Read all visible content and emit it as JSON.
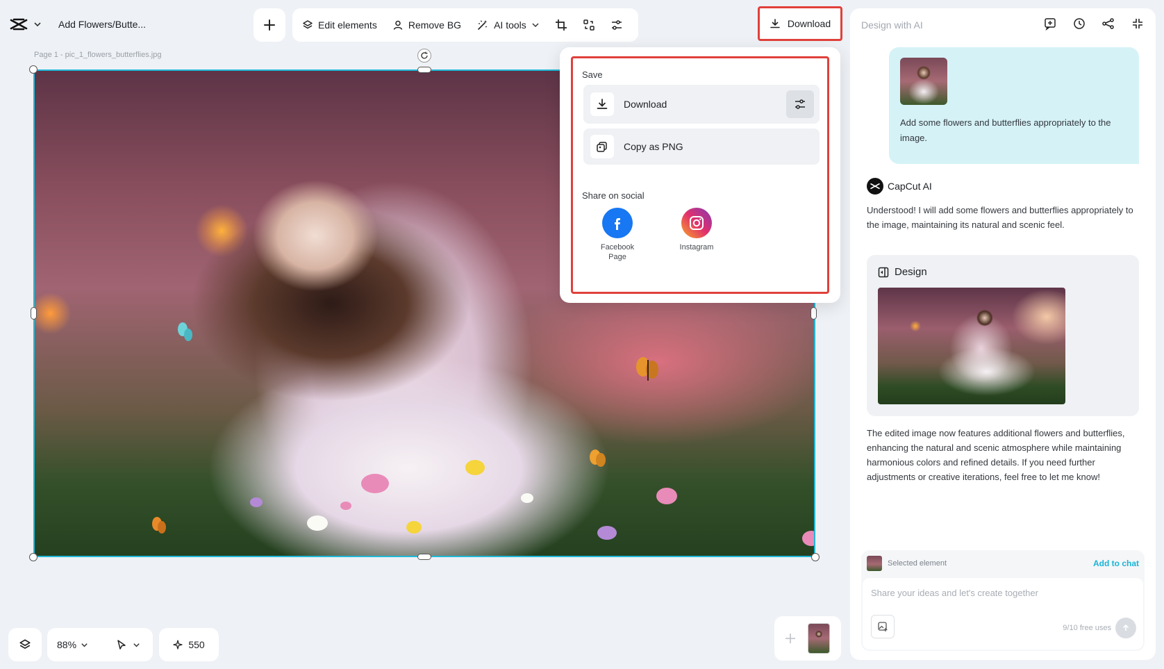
{
  "header": {
    "doc_title": "Add Flowers/Butte...",
    "download_label": "Download"
  },
  "toolbar": {
    "items": [
      {
        "label": "Edit elements",
        "icon": "layers-icon"
      },
      {
        "label": "Remove BG",
        "icon": "person-icon"
      },
      {
        "label": "AI tools",
        "icon": "magic-wand-icon"
      }
    ]
  },
  "canvas": {
    "page_label": "Page 1 -   pic_1_flowers_butterflies.jpg"
  },
  "popup": {
    "save_label": "Save",
    "download_label": "Download",
    "copy_label": "Copy as PNG",
    "share_label": "Share on social",
    "socials": [
      {
        "name": "Facebook\nPage",
        "color": "#1877f2"
      },
      {
        "name": "Instagram",
        "color": "#e1306c"
      }
    ]
  },
  "panel": {
    "title": "Design with AI",
    "user_message": "Add some flowers and butterflies appropriately to the image.",
    "ai_name": "CapCut AI",
    "ai_message": "Understood! I will add some flowers and butterflies appropriately to the image, maintaining its natural and scenic feel.",
    "design_label": "Design",
    "ai_message_2": "The edited image now features additional flowers and butterflies, enhancing the natural and scenic atmosphere while maintaining harmonious colors and refined details. If you need further adjustments or creative iterations, feel free to let me know!",
    "selected_element": "Selected element",
    "add_to_chat": "Add to chat",
    "input_placeholder": "Share your ideas and let's create together",
    "free_uses": "9/10 free uses"
  },
  "bottom": {
    "zoom": "88%",
    "credits": "550"
  },
  "colors": {
    "accent": "#1ab4d6",
    "highlight": "#e0403b"
  }
}
